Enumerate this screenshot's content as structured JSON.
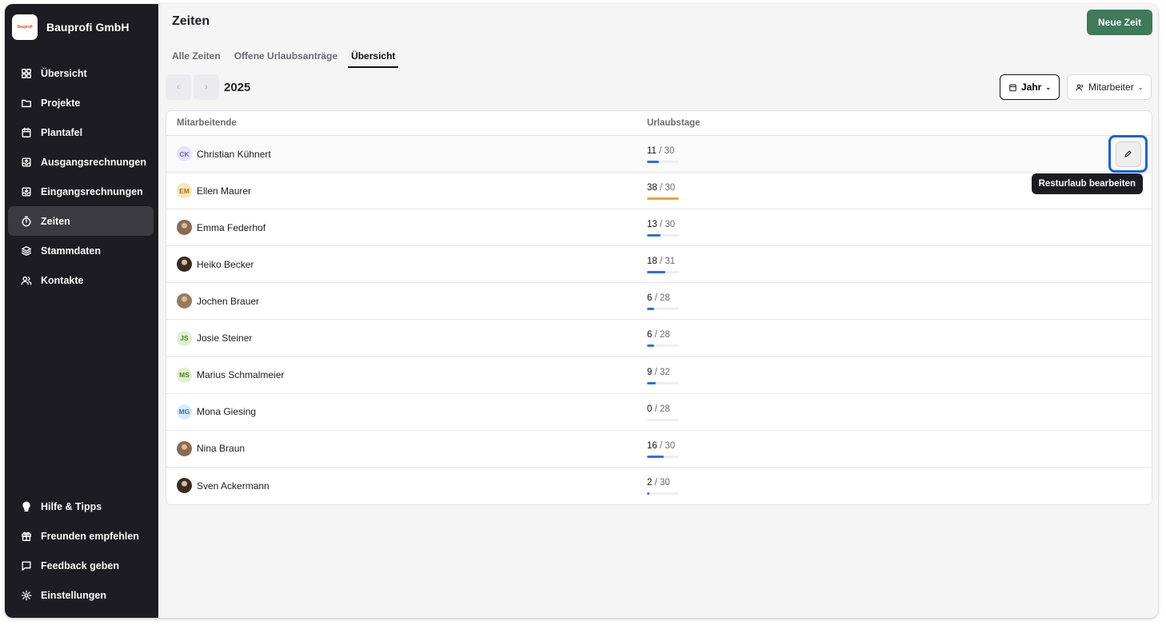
{
  "company": {
    "name": "Bauprofi GmbH",
    "logo_text": "Bauprofi"
  },
  "sidebar": {
    "items": [
      {
        "label": "Übersicht",
        "icon": "grid-icon"
      },
      {
        "label": "Projekte",
        "icon": "folder-icon"
      },
      {
        "label": "Plantafel",
        "icon": "calendar-icon"
      },
      {
        "label": "Ausgangsrechnungen",
        "icon": "outbox-icon"
      },
      {
        "label": "Eingangsrechnungen",
        "icon": "inbox-icon"
      },
      {
        "label": "Zeiten",
        "icon": "stopwatch-icon",
        "active": true
      },
      {
        "label": "Stammdaten",
        "icon": "layers-icon"
      },
      {
        "label": "Kontakte",
        "icon": "users-icon"
      }
    ],
    "bottom_items": [
      {
        "label": "Hilfe & Tipps",
        "icon": "lightbulb-icon"
      },
      {
        "label": "Freunden empfehlen",
        "icon": "gift-icon"
      },
      {
        "label": "Feedback geben",
        "icon": "message-icon"
      },
      {
        "label": "Einstellungen",
        "icon": "gear-icon"
      }
    ]
  },
  "header": {
    "title": "Zeiten",
    "new_button": "Neue Zeit"
  },
  "tabs": [
    {
      "label": "Alle Zeiten"
    },
    {
      "label": "Offene Urlaubsanträge"
    },
    {
      "label": "Übersicht",
      "active": true
    }
  ],
  "toolbar": {
    "prev": "‹",
    "next": "›",
    "year": "2025",
    "period_filter": "Jahr",
    "employee_filter": "Mitarbeiter"
  },
  "table": {
    "columns": [
      "Mitarbeitende",
      "Urlaubstage"
    ],
    "rows": [
      {
        "name": "Christian Kühnert",
        "initials": "CK",
        "used": "11",
        "total": "30"
      },
      {
        "name": "Ellen Maurer",
        "initials": "EM",
        "used": "38",
        "total": "30"
      },
      {
        "name": "Emma Federhof",
        "initials": "",
        "used": "13",
        "total": "30"
      },
      {
        "name": "Heiko Becker",
        "initials": "",
        "used": "18",
        "total": "31"
      },
      {
        "name": "Jochen Brauer",
        "initials": "",
        "used": "6",
        "total": "28"
      },
      {
        "name": "Josie Steiner",
        "initials": "JS",
        "used": "6",
        "total": "28"
      },
      {
        "name": "Marius Schmalmeier",
        "initials": "MS",
        "used": "9",
        "total": "32"
      },
      {
        "name": "Mona Giesing",
        "initials": "MG",
        "used": "0",
        "total": "28"
      },
      {
        "name": "Nina Braun",
        "initials": "",
        "used": "16",
        "total": "30"
      },
      {
        "name": "Sven Ackermann",
        "initials": "",
        "used": "2",
        "total": "30"
      }
    ]
  },
  "tooltip": "Resturlaub bearbeiten",
  "colors": {
    "primary": "#3f7a5a",
    "progress": "#2f6fe3",
    "overflow": "#e3a83a",
    "sidebar": "#1d1d21",
    "focus": "#1762d6"
  }
}
